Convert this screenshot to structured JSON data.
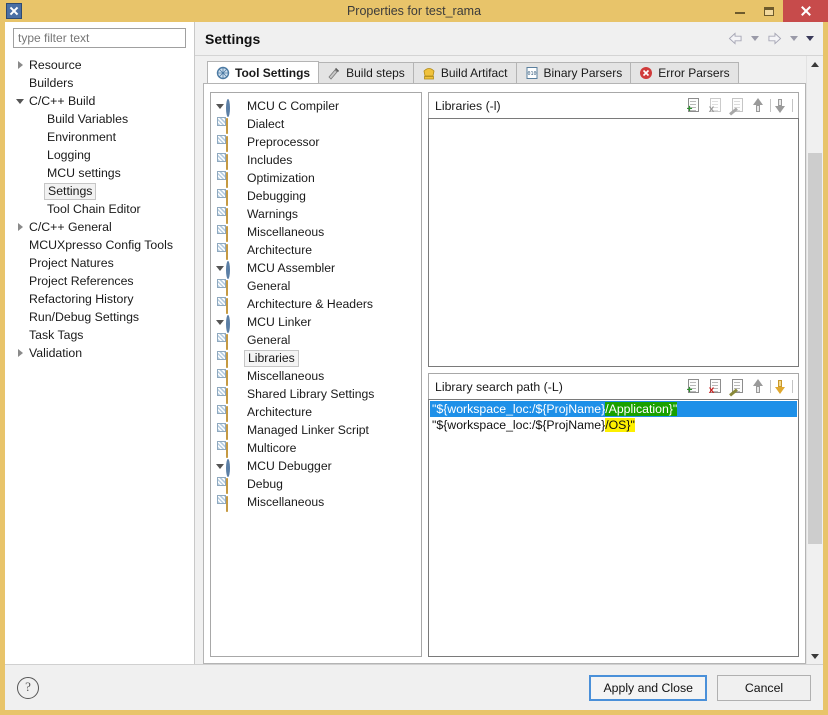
{
  "window": {
    "title": "Properties for test_rama",
    "icon": "app-x-icon",
    "controls": {
      "minimize": "minimize",
      "maximize": "maximize",
      "close": "close"
    }
  },
  "sidebar": {
    "filter_placeholder": "type filter text",
    "filter_value": "",
    "items": [
      {
        "label": "Resource",
        "indent": 0,
        "expander": "collapsed",
        "selected": false
      },
      {
        "label": "Builders",
        "indent": 0,
        "expander": "none",
        "selected": false
      },
      {
        "label": "C/C++ Build",
        "indent": 0,
        "expander": "expanded",
        "selected": false
      },
      {
        "label": "Build Variables",
        "indent": 1,
        "expander": "none",
        "selected": false
      },
      {
        "label": "Environment",
        "indent": 1,
        "expander": "none",
        "selected": false
      },
      {
        "label": "Logging",
        "indent": 1,
        "expander": "none",
        "selected": false
      },
      {
        "label": "MCU settings",
        "indent": 1,
        "expander": "none",
        "selected": false
      },
      {
        "label": "Settings",
        "indent": 1,
        "expander": "none",
        "selected": true
      },
      {
        "label": "Tool Chain Editor",
        "indent": 1,
        "expander": "none",
        "selected": false
      },
      {
        "label": "C/C++ General",
        "indent": 0,
        "expander": "collapsed",
        "selected": false
      },
      {
        "label": "MCUXpresso Config Tools",
        "indent": 0,
        "expander": "none",
        "selected": false
      },
      {
        "label": "Project Natures",
        "indent": 0,
        "expander": "none",
        "selected": false
      },
      {
        "label": "Project References",
        "indent": 0,
        "expander": "none",
        "selected": false
      },
      {
        "label": "Refactoring History",
        "indent": 0,
        "expander": "none",
        "selected": false
      },
      {
        "label": "Run/Debug Settings",
        "indent": 0,
        "expander": "none",
        "selected": false
      },
      {
        "label": "Task Tags",
        "indent": 0,
        "expander": "none",
        "selected": false
      },
      {
        "label": "Validation",
        "indent": 0,
        "expander": "collapsed",
        "selected": false
      }
    ]
  },
  "header": {
    "page_title": "Settings",
    "nav": {
      "back": "back-arrow",
      "back_menu": "back-dropdown",
      "forward": "forward-arrow",
      "forward_menu": "forward-dropdown",
      "view_menu": "view-menu"
    }
  },
  "tabs": [
    {
      "label": "Tool Settings",
      "icon": "tool-settings-icon",
      "active": true
    },
    {
      "label": "Build steps",
      "icon": "build-steps-icon",
      "active": false
    },
    {
      "label": "Build Artifact",
      "icon": "build-artifact-icon",
      "active": false
    },
    {
      "label": "Binary Parsers",
      "icon": "binary-parsers-icon",
      "active": false
    },
    {
      "label": "Error Parsers",
      "icon": "error-parsers-icon",
      "active": false
    }
  ],
  "tool_tree": [
    {
      "label": "MCU C Compiler",
      "level": 0,
      "expander": "expanded",
      "icon": "tool-icon",
      "selected": false
    },
    {
      "label": "Dialect",
      "level": 1,
      "expander": "none",
      "icon": "page-icon",
      "selected": false
    },
    {
      "label": "Preprocessor",
      "level": 1,
      "expander": "none",
      "icon": "page-icon",
      "selected": false
    },
    {
      "label": "Includes",
      "level": 1,
      "expander": "none",
      "icon": "page-icon",
      "selected": false
    },
    {
      "label": "Optimization",
      "level": 1,
      "expander": "none",
      "icon": "page-icon",
      "selected": false
    },
    {
      "label": "Debugging",
      "level": 1,
      "expander": "none",
      "icon": "page-icon",
      "selected": false
    },
    {
      "label": "Warnings",
      "level": 1,
      "expander": "none",
      "icon": "page-icon",
      "selected": false
    },
    {
      "label": "Miscellaneous",
      "level": 1,
      "expander": "none",
      "icon": "page-icon",
      "selected": false
    },
    {
      "label": "Architecture",
      "level": 1,
      "expander": "none",
      "icon": "page-icon",
      "selected": false
    },
    {
      "label": "MCU Assembler",
      "level": 0,
      "expander": "expanded",
      "icon": "tool-icon",
      "selected": false
    },
    {
      "label": "General",
      "level": 1,
      "expander": "none",
      "icon": "page-icon",
      "selected": false
    },
    {
      "label": "Architecture & Headers",
      "level": 1,
      "expander": "none",
      "icon": "page-icon",
      "selected": false
    },
    {
      "label": "MCU Linker",
      "level": 0,
      "expander": "expanded",
      "icon": "tool-icon",
      "selected": false
    },
    {
      "label": "General",
      "level": 1,
      "expander": "none",
      "icon": "page-icon",
      "selected": false
    },
    {
      "label": "Libraries",
      "level": 1,
      "expander": "none",
      "icon": "page-icon",
      "selected": true
    },
    {
      "label": "Miscellaneous",
      "level": 1,
      "expander": "none",
      "icon": "page-icon",
      "selected": false
    },
    {
      "label": "Shared Library Settings",
      "level": 1,
      "expander": "none",
      "icon": "page-icon",
      "selected": false
    },
    {
      "label": "Architecture",
      "level": 1,
      "expander": "none",
      "icon": "page-icon",
      "selected": false
    },
    {
      "label": "Managed Linker Script",
      "level": 1,
      "expander": "none",
      "icon": "page-icon",
      "selected": false
    },
    {
      "label": "Multicore",
      "level": 1,
      "expander": "none",
      "icon": "page-icon",
      "selected": false
    },
    {
      "label": "MCU Debugger",
      "level": 0,
      "expander": "expanded",
      "icon": "tool-icon",
      "selected": false
    },
    {
      "label": "Debug",
      "level": 1,
      "expander": "none",
      "icon": "page-icon",
      "selected": false
    },
    {
      "label": "Miscellaneous",
      "level": 1,
      "expander": "none",
      "icon": "page-icon",
      "selected": false
    }
  ],
  "libraries_group": {
    "title": "Libraries (-l)",
    "tools": [
      {
        "name": "add",
        "icon": "add-icon",
        "enabled": true
      },
      {
        "name": "delete",
        "icon": "delete-icon",
        "enabled": false
      },
      {
        "name": "edit",
        "icon": "edit-icon",
        "enabled": false
      },
      {
        "name": "move-up",
        "icon": "move-up-icon",
        "enabled": false
      },
      {
        "name": "move-down",
        "icon": "move-down-icon",
        "enabled": false
      }
    ],
    "rows": []
  },
  "search_path_group": {
    "title": "Library search path (-L)",
    "tools": [
      {
        "name": "add",
        "icon": "add-icon",
        "enabled": true
      },
      {
        "name": "delete",
        "icon": "delete-icon",
        "enabled": true
      },
      {
        "name": "edit",
        "icon": "edit-icon",
        "enabled": true
      },
      {
        "name": "move-up",
        "icon": "move-up-icon",
        "enabled": false
      },
      {
        "name": "move-down",
        "icon": "move-down-icon",
        "enabled": true
      }
    ],
    "rows": [
      {
        "selected": true,
        "segments": [
          {
            "text": "\"${workspace_loc:/${ProjName}",
            "highlight": false
          },
          {
            "text": "/Application}\"",
            "highlight": true
          }
        ]
      },
      {
        "selected": false,
        "segments": [
          {
            "text": "\"${workspace_loc:/${ProjName}",
            "highlight": false
          },
          {
            "text": "/OS}\"",
            "highlight": true
          }
        ]
      }
    ]
  },
  "scrollbar": {
    "up": "scroll-up",
    "down": "scroll-down",
    "thumb": "scroll-thumb"
  },
  "footer": {
    "help": "?",
    "apply_label": "Apply and Close",
    "cancel_label": "Cancel"
  },
  "colors": {
    "window_chrome": "#e8c46a",
    "close_button": "#c74b4b",
    "selection": "#1e90e8",
    "highlight": "#fdf000",
    "highlight_on_selection": "#18a000",
    "default_button_border": "#4a90d9"
  }
}
